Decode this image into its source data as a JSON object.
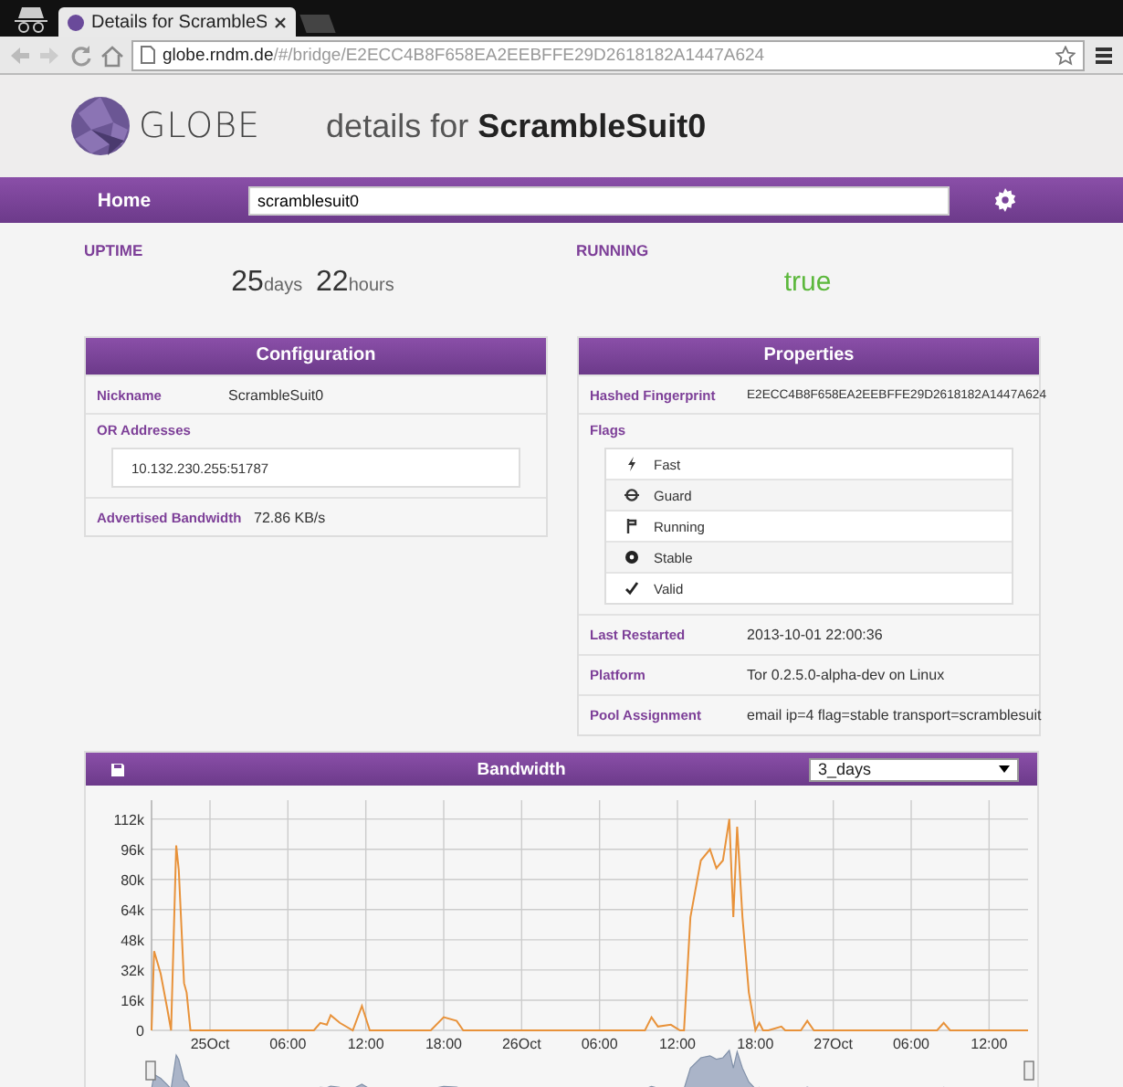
{
  "browser": {
    "tab_title": "Details for ScrambleS",
    "url": {
      "host": "globe.rndm.de",
      "path": "/#/bridge/E2ECC4B8F658EA2EEBFFE29D2618182A1447A624"
    }
  },
  "header": {
    "logo_text": "GLOBE",
    "title": "details for **ScrambleSuit0**"
  },
  "nav": {
    "home": "Home",
    "search": {
      "value": "scramblesuit0"
    }
  },
  "uptime": {
    "label": "UPTIME",
    "days": "25",
    "days_unit": "days",
    "hours": "22",
    "hours_unit": "hours"
  },
  "running": {
    "label": "RUNNING",
    "value": "true"
  },
  "configuration": {
    "title": "Configuration",
    "nickname_label": "Nickname",
    "nickname": "ScrambleSuit0",
    "or_label": "OR Addresses",
    "or_addresses": [
      "10.132.230.255:51787"
    ],
    "bandwidth_label": "Advertised Bandwidth",
    "bandwidth": "72.86 KB/s"
  },
  "properties": {
    "title": "Properties",
    "fingerprint_label": "Hashed Fingerprint",
    "fingerprint": "E2ECC4B8F658EA2EEBFFE29D2618182A1447A624",
    "flags_label": "Flags",
    "flags": [
      {
        "kind": "bolt",
        "label": "Fast"
      },
      {
        "kind": "guard",
        "label": "Guard"
      },
      {
        "kind": "branch",
        "label": "Running"
      },
      {
        "kind": "dot",
        "label": "Stable"
      },
      {
        "kind": "check",
        "label": "Valid"
      }
    ],
    "rows": [
      {
        "label": "Last Restarted",
        "value": "2013-10-01 22:00:36"
      },
      {
        "label": "Platform",
        "value": "Tor 0.2.5.0-alpha-dev on Linux"
      },
      {
        "label": "Pool Assignment",
        "value": "email ip=4 flag=stable transport=scramblesuit"
      }
    ]
  },
  "bandwidth": {
    "title": "Bandwidth",
    "period": "3_days",
    "chart_data": {
      "type": "line",
      "x": [
        "2013-10-24T19:30",
        "2013-10-24T19:42",
        "2013-10-24T20:12",
        "2013-10-24T20:42",
        "2013-10-24T21:00",
        "2013-10-24T21:24",
        "2013-10-24T21:36",
        "2013-10-24T22:00",
        "2013-10-24T22:12",
        "2013-10-24T22:30",
        "2013-10-25T00:00",
        "2013-10-25T08:00",
        "2013-10-25T08:30",
        "2013-10-25T09:00",
        "2013-10-25T09:18",
        "2013-10-25T10:00",
        "2013-10-25T11:00",
        "2013-10-25T11:42",
        "2013-10-25T12:18",
        "2013-10-25T17:00",
        "2013-10-25T18:00",
        "2013-10-25T19:00",
        "2013-10-25T19:30",
        "2013-10-26T09:30",
        "2013-10-26T10:00",
        "2013-10-26T10:30",
        "2013-10-26T11:30",
        "2013-10-26T12:12",
        "2013-10-26T12:30",
        "2013-10-26T13:00",
        "2013-10-26T13:48",
        "2013-10-26T14:30",
        "2013-10-26T15:00",
        "2013-10-26T15:30",
        "2013-10-26T16:00",
        "2013-10-26T16:18",
        "2013-10-26T16:36",
        "2013-10-26T17:00",
        "2013-10-26T17:30",
        "2013-10-26T18:00",
        "2013-10-26T18:18",
        "2013-10-26T18:36",
        "2013-10-26T19:00",
        "2013-10-26T20:00",
        "2013-10-26T20:18",
        "2013-10-26T21:30",
        "2013-10-26T22:00",
        "2013-10-26T22:30",
        "2013-10-27T08:00",
        "2013-10-27T08:30",
        "2013-10-27T09:00",
        "2013-10-27T15:00"
      ],
      "series": [
        {
          "color": "#e8923a",
          "values": [
            0,
            42000,
            30000,
            12000,
            0,
            98000,
            85000,
            25000,
            20000,
            0,
            0,
            0,
            4000,
            3000,
            8000,
            4000,
            0,
            13000,
            0,
            0,
            7000,
            5000,
            0,
            0,
            7000,
            2000,
            3000,
            0,
            0,
            60000,
            90000,
            96000,
            86000,
            90000,
            112000,
            60000,
            108000,
            60000,
            20000,
            0,
            4000,
            0,
            0,
            2000,
            0,
            0,
            5000,
            0,
            0,
            4000,
            0,
            0
          ]
        }
      ],
      "xticks": [
        {
          "value": "2013-10-25T00:00",
          "label": "25Oct"
        },
        {
          "value": "2013-10-25T06:00",
          "label": "06:00"
        },
        {
          "value": "2013-10-25T12:00",
          "label": "12:00"
        },
        {
          "value": "2013-10-25T18:00",
          "label": "18:00"
        },
        {
          "value": "2013-10-26T00:00",
          "label": "26Oct"
        },
        {
          "value": "2013-10-26T06:00",
          "label": "06:00"
        },
        {
          "value": "2013-10-26T12:00",
          "label": "12:00"
        },
        {
          "value": "2013-10-26T18:00",
          "label": "18:00"
        },
        {
          "value": "2013-10-27T00:00",
          "label": "27Oct"
        },
        {
          "value": "2013-10-27T06:00",
          "label": "06:00"
        },
        {
          "value": "2013-10-27T12:00",
          "label": "12:00"
        }
      ],
      "yticks": [
        {
          "value": 0,
          "label": "0"
        },
        {
          "value": 16000,
          "label": "16k"
        },
        {
          "value": 32000,
          "label": "32k"
        },
        {
          "value": 48000,
          "label": "48k"
        },
        {
          "value": 64000,
          "label": "64k"
        },
        {
          "value": 80000,
          "label": "80k"
        },
        {
          "value": 96000,
          "label": "96k"
        },
        {
          "value": 112000,
          "label": "112k"
        }
      ],
      "xlim": [
        "2013-10-24T19:30",
        "2013-10-27T15:00"
      ],
      "ylim": [
        0,
        122000
      ],
      "grid": true
    }
  }
}
